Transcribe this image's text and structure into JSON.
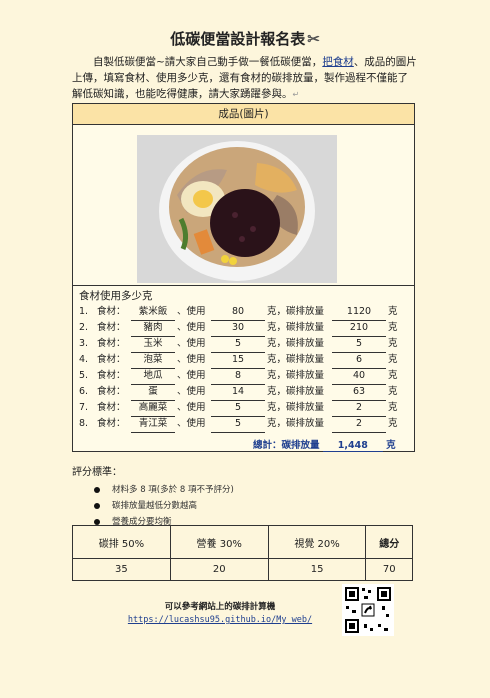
{
  "title": "低碳便當設計報名表",
  "intro": {
    "text_before": "自製低碳便當~請大家自己動手做一餐低碳便當，",
    "link_text": "把食材",
    "text_after": "、成品的圖片上傳，填寫食材、使用多少克，還有食材的碳排放量，製作過程不僅能了解低碳知識，也能吃得健康，請大家踴躍參與。"
  },
  "main_table": {
    "header": "成品(圖片)",
    "ingredients_title": "食材使用多少克",
    "labels": {
      "ingredient": "食材：",
      "use": "、使用",
      "gram_carbon": "克，碳排放量",
      "gram_end": "克"
    },
    "ingredients": [
      {
        "num": "1.",
        "name": "紫米飯",
        "grams": "80",
        "carbon": "1120"
      },
      {
        "num": "2.",
        "name": "豬肉",
        "grams": "30",
        "carbon": "210"
      },
      {
        "num": "3.",
        "name": "玉米",
        "grams": "5",
        "carbon": "5"
      },
      {
        "num": "4.",
        "name": "泡菜",
        "grams": "15",
        "carbon": "6"
      },
      {
        "num": "5.",
        "name": "地瓜",
        "grams": "8",
        "carbon": "40"
      },
      {
        "num": "6.",
        "name": "蛋",
        "grams": "14",
        "carbon": "63"
      },
      {
        "num": "7.",
        "name": "高麗菜",
        "grams": "5",
        "carbon": "2"
      },
      {
        "num": "8.",
        "name": "青江菜",
        "grams": "5",
        "carbon": "2"
      }
    ],
    "total_label": "總計：碳排放量",
    "total_value": "1,448",
    "total_unit": "克"
  },
  "score_section": {
    "label": "評分標準：",
    "bullets": [
      "材料多 8 項(多於 8 項不予評分)",
      "碳排放量越低分數越高",
      "營養成分要均衡"
    ],
    "headers": [
      "碳排 50%",
      "營養 30%",
      "視覺 20%",
      "總分"
    ],
    "values": [
      "35",
      "20",
      "15",
      "70"
    ]
  },
  "reference": {
    "text": "可以參考網站上的碳排計算機",
    "link": "https://lucashsu95.github.io/My_web/"
  }
}
